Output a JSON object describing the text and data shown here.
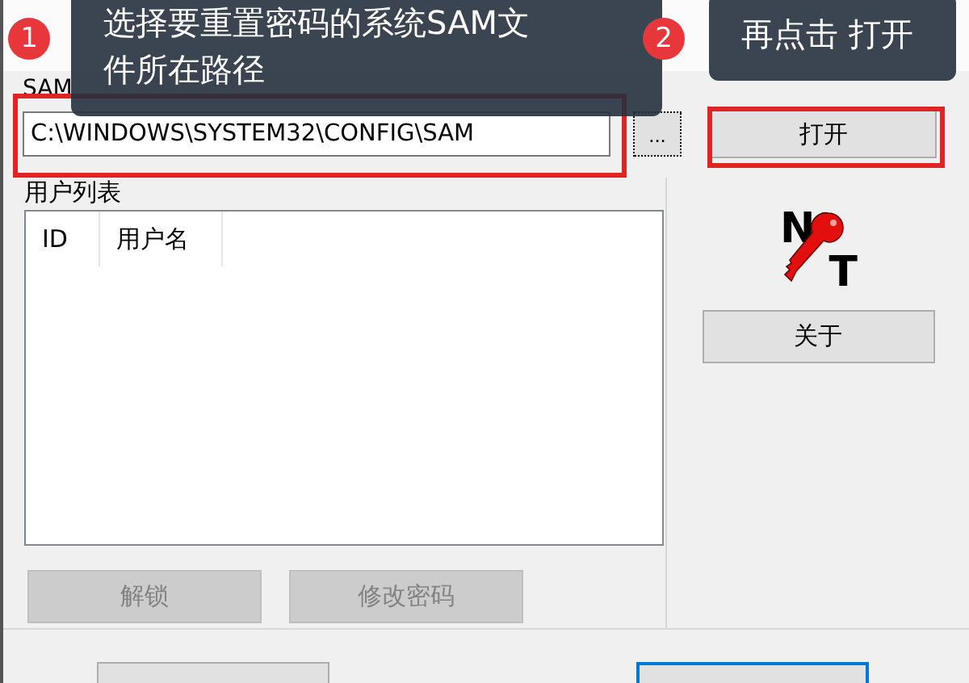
{
  "annotations": [
    {
      "number": "1",
      "text": "选择要重置密码的系统SAM文件所在路径"
    },
    {
      "number": "2",
      "text": "再点击 打开"
    }
  ],
  "sam_label": "SAM",
  "path_field": {
    "value": "C:\\WINDOWS\\SYSTEM32\\CONFIG\\SAM",
    "highlighted": true
  },
  "browse_button": {
    "label": "..."
  },
  "open_button": {
    "label": "打开",
    "highlighted": true
  },
  "user_list": {
    "title": "用户列表",
    "columns": [
      "ID",
      "用户名"
    ]
  },
  "logo": {
    "letters": [
      "N",
      "T"
    ]
  },
  "about_button": {
    "label": "关于"
  },
  "action_buttons": [
    {
      "label": "解锁",
      "disabled": true
    },
    {
      "label": "修改密码",
      "disabled": true
    }
  ],
  "bottom_buttons": [
    {
      "focused": false
    },
    {
      "focused": true
    }
  ]
}
